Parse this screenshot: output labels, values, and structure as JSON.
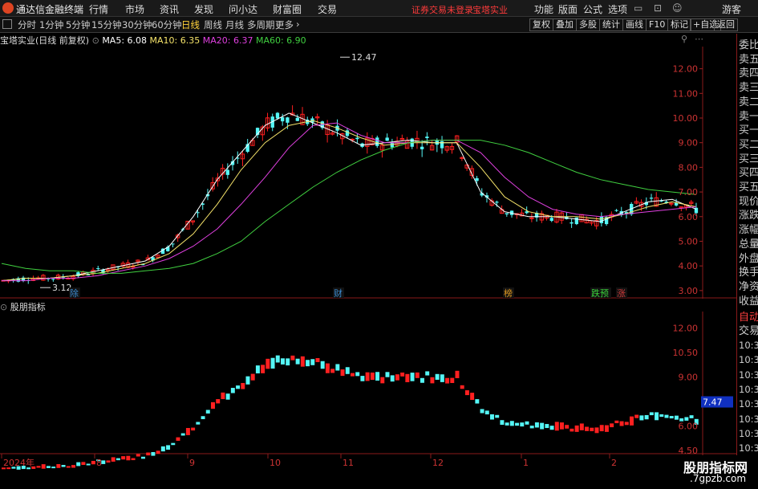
{
  "app": {
    "title": "通达信金融终端",
    "menus": [
      "行情",
      "市场",
      "资讯",
      "发现",
      "问小达",
      "财富圈",
      "交易"
    ],
    "notice": "证券交易未登录",
    "stock_name": "宝塔实业",
    "right_menus": [
      "功能",
      "版面",
      "公式",
      "选项"
    ],
    "guest": "游客"
  },
  "toolbar": {
    "periods": [
      "分时",
      "1分钟",
      "5分钟",
      "15分钟",
      "30分钟",
      "60分钟",
      "日线",
      "周线",
      "月线",
      "多周期",
      "更多"
    ],
    "active_period": "日线",
    "buttons": [
      "复权",
      "叠加",
      "多股",
      "统计",
      "画线",
      "F10",
      "标记",
      "+自选",
      "返回"
    ]
  },
  "ma_line": {
    "title": "宝塔实业(日线 前复权)",
    "ma5": "MA5: 6.08",
    "ma10": "MA10: 6.35",
    "ma20": "MA20: 6.37",
    "ma60": "MA60: 6.90"
  },
  "indicator": {
    "name": "股朋指标"
  },
  "right_panel": {
    "items": [
      "委比",
      "卖五",
      "卖四",
      "卖三",
      "卖二",
      "卖一",
      "买一",
      "买二",
      "买三",
      "买四",
      "买五",
      "现价",
      "涨跌",
      "涨幅",
      "总量",
      "外盘",
      "换手",
      "净资",
      "收益",
      "自动",
      "交易"
    ],
    "times": [
      "10:30",
      "10:30",
      "10:30",
      "10:30",
      "10:30",
      "10:31",
      "10:31",
      "10:31",
      "10:31"
    ]
  },
  "colors": {
    "up": "#ff2020",
    "down": "#54f6f6",
    "ma5": "#ffffff",
    "ma10": "#f5e36a",
    "ma20": "#e040e0",
    "ma60": "#40d040"
  },
  "chart_data": [
    {
      "type": "candlestick",
      "title": "宝塔实业(日线 前复权)",
      "ylim": [
        2.8,
        12.9
      ],
      "yticks": [
        "12.00",
        "11.00",
        "10.00",
        "9.00",
        "8.00",
        "7.00",
        "6.00",
        "5.00",
        "4.00",
        "3.00"
      ],
      "yticks_values": [
        12,
        11,
        10,
        9,
        8,
        7,
        6,
        5,
        4,
        3
      ],
      "annotations": {
        "high": "12.47",
        "low": "3.12"
      },
      "event_markers": [
        "除",
        "财",
        "榜",
        "跌预",
        "涨"
      ],
      "series": [
        {
          "name": "MA5",
          "values": [
            3.4,
            3.5,
            3.5,
            3.6,
            3.8,
            4.0,
            4.2,
            4.8,
            6.0,
            7.5,
            8.6,
            9.7,
            10.2,
            9.8,
            9.4,
            8.9,
            9.0,
            9.1,
            9.0,
            9.0,
            7.0,
            6.2,
            6.0,
            6.0,
            5.9,
            5.8,
            6.2,
            6.6,
            6.7,
            6.3
          ]
        },
        {
          "name": "MA10",
          "values": [
            3.4,
            3.5,
            3.5,
            3.6,
            3.7,
            3.9,
            4.1,
            4.5,
            5.3,
            6.5,
            7.9,
            9.0,
            9.7,
            9.9,
            9.6,
            9.2,
            8.9,
            9.0,
            9.0,
            9.0,
            8.0,
            6.8,
            6.2,
            6.0,
            6.0,
            5.9,
            6.1,
            6.4,
            6.6,
            6.4
          ]
        },
        {
          "name": "MA20",
          "values": [
            3.4,
            3.4,
            3.5,
            3.5,
            3.6,
            3.8,
            4.0,
            4.3,
            4.8,
            5.5,
            6.5,
            7.6,
            8.8,
            9.7,
            9.8,
            9.3,
            9.0,
            9.0,
            9.1,
            9.1,
            8.6,
            7.6,
            6.8,
            6.3,
            6.1,
            6.0,
            6.1,
            6.2,
            6.3,
            6.4
          ]
        },
        {
          "name": "MA60",
          "values": [
            4.1,
            3.9,
            3.8,
            3.8,
            3.7,
            3.7,
            3.8,
            3.9,
            4.1,
            4.5,
            5.0,
            5.8,
            6.5,
            7.2,
            7.8,
            8.3,
            8.7,
            9.0,
            9.1,
            9.1,
            9.1,
            8.9,
            8.6,
            8.2,
            7.8,
            7.5,
            7.3,
            7.1,
            7.0,
            6.9
          ]
        }
      ]
    },
    {
      "type": "bar",
      "title": "股朋指标",
      "ylim": [
        4.4,
        13.0
      ],
      "yticks": [
        "12.00",
        "10.50",
        "9.00",
        "7.47",
        "6.00",
        "4.50"
      ],
      "yticks_values": [
        12,
        10.5,
        9,
        7.47,
        6,
        4.5
      ],
      "x_labels": [
        "2024年",
        "8",
        "9",
        "10",
        "11",
        "12",
        "1",
        "2"
      ]
    }
  ]
}
